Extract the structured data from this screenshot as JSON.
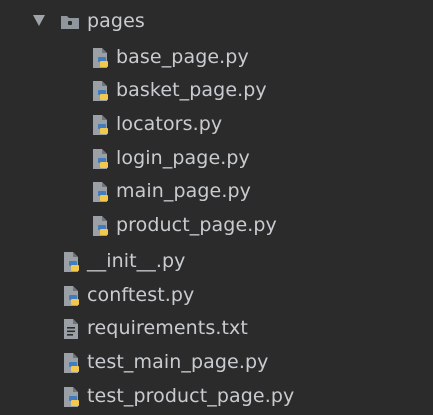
{
  "tree": {
    "folder": {
      "name": "pages",
      "expanded": true,
      "icon": "folder-icon",
      "children": [
        {
          "name": "base_page.py",
          "icon": "python-file-icon"
        },
        {
          "name": "basket_page.py",
          "icon": "python-file-icon"
        },
        {
          "name": "locators.py",
          "icon": "python-file-icon"
        },
        {
          "name": "login_page.py",
          "icon": "python-file-icon"
        },
        {
          "name": "main_page.py",
          "icon": "python-file-icon"
        },
        {
          "name": "product_page.py",
          "icon": "python-file-icon"
        }
      ]
    },
    "files": [
      {
        "name": "__init__.py",
        "icon": "python-file-icon"
      },
      {
        "name": "conftest.py",
        "icon": "python-file-icon"
      },
      {
        "name": "requirements.txt",
        "icon": "text-file-icon"
      },
      {
        "name": "test_main_page.py",
        "icon": "python-file-icon"
      },
      {
        "name": "test_product_page.py",
        "icon": "python-file-icon"
      }
    ]
  },
  "colors": {
    "background": "#2b2b2b",
    "text": "#c8ccd0",
    "folder": "#8f969d",
    "python_blue": "#3f7cc0",
    "python_yellow": "#f2c94c",
    "file_gray": "#9aa0a6"
  }
}
